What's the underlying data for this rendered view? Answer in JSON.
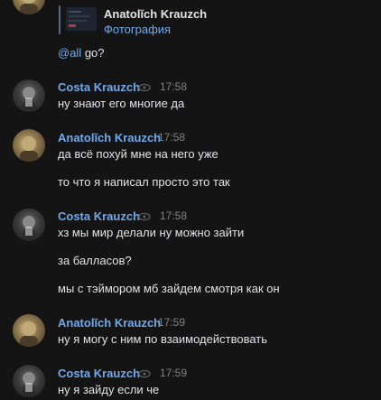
{
  "reply": {
    "name": "Anatolĭch Krauzch",
    "subtitle": "Фотография"
  },
  "first_message": {
    "mention": "@all",
    "text": " go?"
  },
  "groups": [
    {
      "author": "Costa Krauzch",
      "time": "17:58",
      "messages": [
        "ну знают его многие да"
      ]
    },
    {
      "author": "Anatolĭch Krauzch",
      "time": "17:58",
      "messages": [
        "да всё похуй мне на него уже",
        "то что я написал просто это так"
      ]
    },
    {
      "author": "Costa Krauzch",
      "time": "17:58",
      "messages": [
        "хз мы мир делали ну можно зайти",
        "за балласов?",
        "мы с тэймором мб зайдем смотря как он"
      ]
    },
    {
      "author": "Anatolĭch Krauzch",
      "time": "17:59",
      "messages": [
        "ну я могу с ним по взаимодействовать"
      ]
    },
    {
      "author": "Costa Krauzch",
      "time": "17:59",
      "messages": [
        "ну я зайду если че"
      ]
    }
  ],
  "colors": {
    "background": "#141414",
    "author": "#71aaeb",
    "text": "#e1e3e6",
    "time": "#828282"
  },
  "icons": [
    "eye-icon",
    "avatar-costa",
    "avatar-anatolich",
    "photo-thumbnail"
  ]
}
